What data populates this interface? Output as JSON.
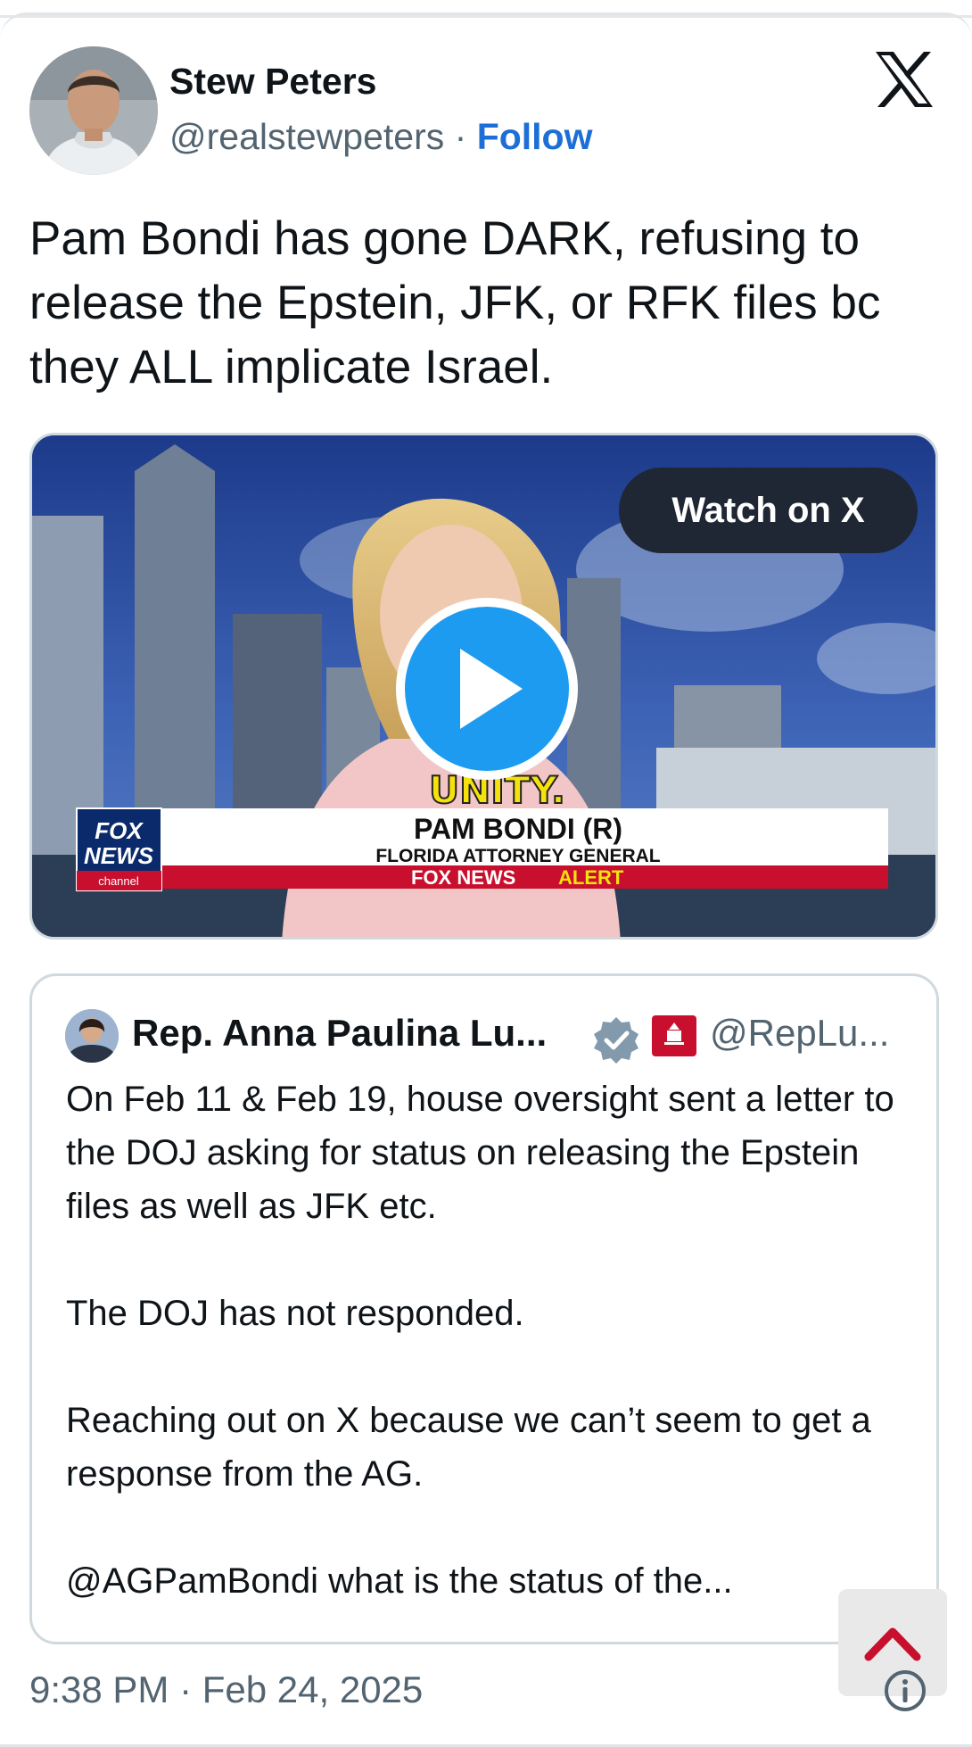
{
  "author": {
    "name": "Stew Peters",
    "handle": "@realstewpeters",
    "separator": " · ",
    "follow_label": "Follow"
  },
  "tweet": {
    "text": "Pam Bondi has gone DARK, refusing to release the Epstein, JFK, or RFK files bc they ALL implicate Israel."
  },
  "media": {
    "watch_label": "Watch on X",
    "chyron_unity": "UNITY.",
    "chyron_name": "PAM BONDI (R)",
    "chyron_title": "FLORIDA ATTORNEY GENERAL",
    "alert_prefix": "FOX NEWS",
    "alert_suffix": "ALERT",
    "logo_top": "FOX",
    "logo_bottom": "NEWS",
    "logo_channel": "channel"
  },
  "quote": {
    "name": "Rep. Anna Paulina Lu...",
    "handle": "@RepLu...",
    "paragraphs": [
      "On Feb 11 & Feb 19, house oversight sent a letter to the DOJ asking for status on releasing the Epstein files as well as JFK etc.",
      "The DOJ has not responded.",
      "Reaching out on X because we can’t seem to get a response from the AG.",
      "@AGPamBondi what is the status of the..."
    ]
  },
  "footer": {
    "timestamp": "9:38 PM · Feb 24, 2025"
  },
  "colors": {
    "follow": "#1d6fd6",
    "play": "#1d9bf0",
    "verified": "#829aab",
    "scroll_arrow": "#c8102e"
  }
}
